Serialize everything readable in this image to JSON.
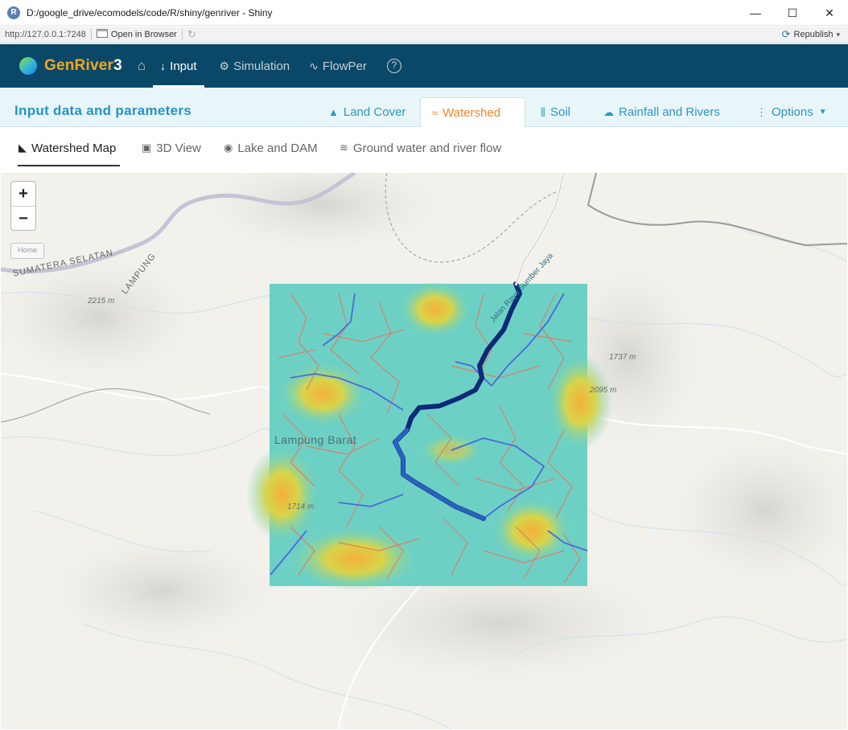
{
  "window": {
    "title": "D:/google_drive/ecomodels/code/R/shiny/genriver - Shiny",
    "app_icon_letter": "R",
    "minimize": "—",
    "maximize": "☐",
    "close": "✕"
  },
  "toolbar": {
    "url": "http://127.0.0.1:7248",
    "open_in_browser": "Open in Browser",
    "republish": "Republish"
  },
  "navbar": {
    "brand_prefix": "GenRiver",
    "brand_suffix": "3",
    "items": [
      {
        "label": "Input",
        "icon": "arrow-down-icon",
        "active": true
      },
      {
        "label": "Simulation",
        "icon": "gears-icon",
        "active": false
      },
      {
        "label": "FlowPer",
        "icon": "wave-icon",
        "active": false
      }
    ],
    "help": "?"
  },
  "section": {
    "title": "Input data and parameters",
    "tabs": [
      {
        "label": "Land Cover",
        "icon": "tree-icon"
      },
      {
        "label": "Watershed",
        "icon": "water-icon",
        "active": true
      },
      {
        "label": "Soil",
        "icon": "soil-icon"
      },
      {
        "label": "Rainfall and Rivers",
        "icon": "cloud-icon"
      },
      {
        "label": "Options",
        "icon": "kebab-icon"
      }
    ]
  },
  "subtabs": [
    {
      "label": "Watershed Map",
      "icon": "mountain-icon",
      "active": true
    },
    {
      "label": "3D View",
      "icon": "cube-icon"
    },
    {
      "label": "Lake and DAM",
      "icon": "fish-icon"
    },
    {
      "label": "Ground water and river flow",
      "icon": "water-wave-icon"
    }
  ],
  "map": {
    "zoom_in": "+",
    "zoom_out": "−",
    "home": "Home",
    "labels": {
      "sumatera_selatan": "SUMATERA SELATAN",
      "lampung": "LAMPUNG",
      "lampung_barat": "Lampung Barat",
      "road": "Jalan Raya Sumber Jaya",
      "peak1": "2215 m",
      "peak2": "1737 m",
      "peak3": "2095 m",
      "peak4": "1714 m"
    }
  }
}
